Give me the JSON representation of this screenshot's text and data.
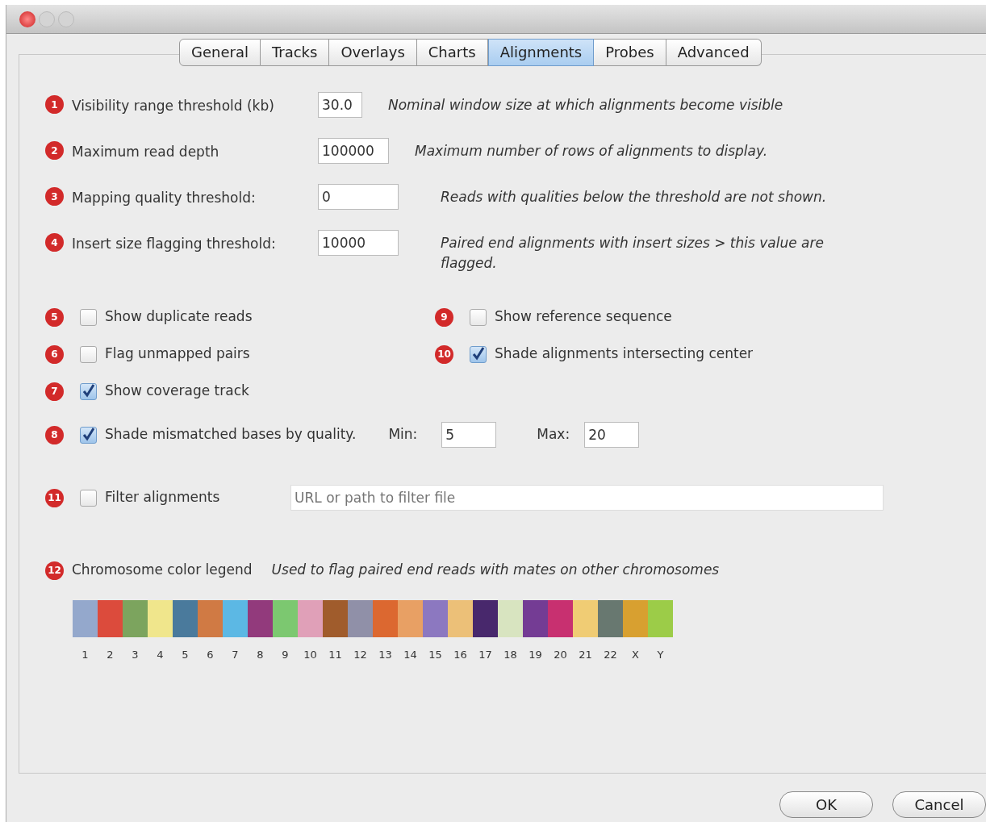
{
  "tabs": [
    {
      "label": "General",
      "selected": false
    },
    {
      "label": "Tracks",
      "selected": false
    },
    {
      "label": "Overlays",
      "selected": false
    },
    {
      "label": "Charts",
      "selected": false
    },
    {
      "label": "Alignments",
      "selected": true
    },
    {
      "label": "Probes",
      "selected": false
    },
    {
      "label": "Advanced",
      "selected": false
    }
  ],
  "fields": [
    {
      "marker": "1",
      "label": "Visibility range threshold (kb)",
      "value": "30.0",
      "description": "Nominal window size at which alignments become visible"
    },
    {
      "marker": "2",
      "label": "Maximum read depth",
      "value": "100000",
      "description": "Maximum number of rows of alignments to display."
    },
    {
      "marker": "3",
      "label": "Mapping quality threshold:",
      "value": "0",
      "description": "Reads with qualities below the threshold are not shown."
    },
    {
      "marker": "4",
      "label": "Insert size flagging threshold:",
      "value": "10000",
      "description": "Paired end alignments with insert sizes > this value are flagged."
    }
  ],
  "options_left": [
    {
      "marker": "5",
      "label": "Show duplicate reads",
      "checked": false
    },
    {
      "marker": "6",
      "label": "Flag unmapped pairs",
      "checked": false
    },
    {
      "marker": "7",
      "label": "Show coverage track",
      "checked": true
    },
    {
      "marker": "8",
      "label": "Shade mismatched bases by quality.",
      "checked": true,
      "min": {
        "label": "Min:",
        "value": "5"
      },
      "max": {
        "label": "Max:",
        "value": "20"
      }
    }
  ],
  "options_right": [
    {
      "marker": "9",
      "label": "Show reference sequence",
      "checked": false
    },
    {
      "marker": "10",
      "label": "Shade alignments intersecting center",
      "checked": true
    }
  ],
  "filter": {
    "marker": "11",
    "label": "Filter alignments",
    "checked": false,
    "placeholder": "URL or path to filter file"
  },
  "legend": {
    "marker": "12",
    "label": "Chromosome color legend",
    "description": "Used to flag paired end reads with mates on other chromosomes",
    "swatches": [
      {
        "label": "1",
        "color": "#94a8cc"
      },
      {
        "label": "2",
        "color": "#dc4b3c"
      },
      {
        "label": "3",
        "color": "#7ca45e"
      },
      {
        "label": "4",
        "color": "#f0e68c"
      },
      {
        "label": "5",
        "color": "#4a7a9c"
      },
      {
        "label": "6",
        "color": "#d07a44"
      },
      {
        "label": "7",
        "color": "#5cb8e4"
      },
      {
        "label": "8",
        "color": "#923a7c"
      },
      {
        "label": "9",
        "color": "#7cc870"
      },
      {
        "label": "10",
        "color": "#e0a0b8"
      },
      {
        "label": "11",
        "color": "#a05c2c"
      },
      {
        "label": "12",
        "color": "#9090a8"
      },
      {
        "label": "13",
        "color": "#dc6830"
      },
      {
        "label": "14",
        "color": "#e8a064"
      },
      {
        "label": "15",
        "color": "#8c78c0"
      },
      {
        "label": "16",
        "color": "#ecc078"
      },
      {
        "label": "17",
        "color": "#48286c"
      },
      {
        "label": "18",
        "color": "#d8e4c0"
      },
      {
        "label": "19",
        "color": "#743c94"
      },
      {
        "label": "20",
        "color": "#c83070"
      },
      {
        "label": "21",
        "color": "#f0cc74"
      },
      {
        "label": "22",
        "color": "#687870"
      },
      {
        "label": "X",
        "color": "#d8a030"
      },
      {
        "label": "Y",
        "color": "#9ccc48"
      }
    ]
  },
  "buttons": [
    {
      "label": "OK"
    },
    {
      "label": "Cancel"
    }
  ]
}
